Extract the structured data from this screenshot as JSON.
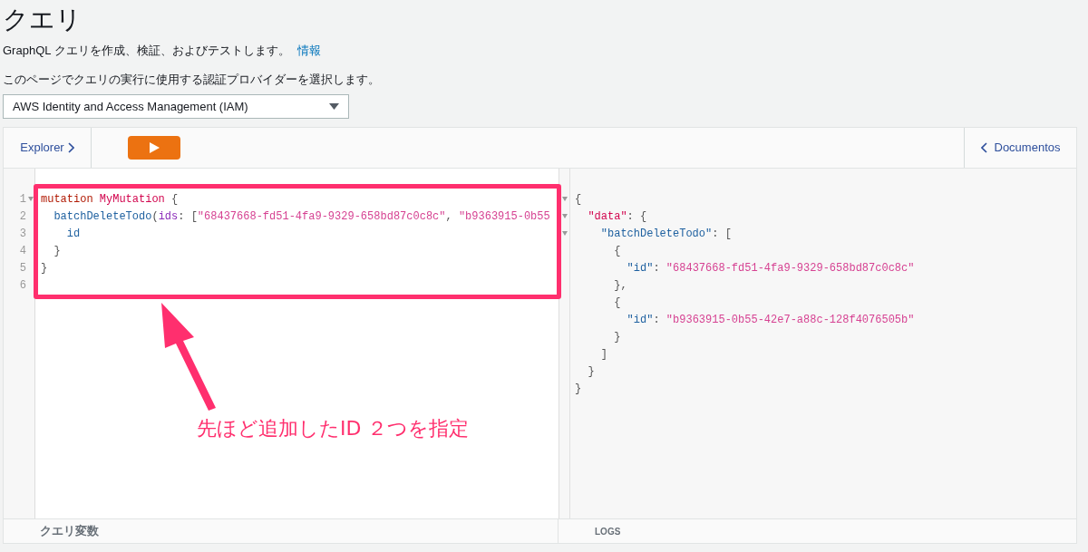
{
  "page": {
    "title": "クエリ",
    "description": "GraphQL クエリを作成、検証、およびテストします。",
    "info_link": "情報",
    "auth_note": "このページでクエリの実行に使用する認証プロバイダーを選択します。",
    "auth_select": "AWS Identity and Access Management (IAM)"
  },
  "toolbar": {
    "explorer": "Explorer",
    "docs": "Documentos"
  },
  "editor": {
    "lines": [
      {
        "number": "1",
        "foldable": true,
        "tokens": [
          {
            "kind": "keyword",
            "text": "mutation "
          },
          {
            "kind": "name",
            "text": "MyMutation"
          },
          {
            "kind": "punct",
            "text": " {"
          }
        ]
      },
      {
        "number": "2",
        "foldable": false,
        "tokens": [
          {
            "kind": "field",
            "text": "  batchDeleteTodo"
          },
          {
            "kind": "punct",
            "text": "("
          },
          {
            "kind": "arg",
            "text": "ids"
          },
          {
            "kind": "punct",
            "text": ": ["
          },
          {
            "kind": "string",
            "text": "\"68437668-fd51-4fa9-9329-658bd87c0c8c\""
          },
          {
            "kind": "punct",
            "text": ", "
          },
          {
            "kind": "string",
            "text": "\"b9363915-0b55"
          }
        ]
      },
      {
        "number": "3",
        "foldable": false,
        "tokens": [
          {
            "kind": "field",
            "text": "    id"
          }
        ]
      },
      {
        "number": "4",
        "foldable": false,
        "tokens": [
          {
            "kind": "punct",
            "text": "  }"
          }
        ]
      },
      {
        "number": "5",
        "foldable": false,
        "tokens": [
          {
            "kind": "punct",
            "text": "}"
          }
        ]
      },
      {
        "number": "6",
        "foldable": false
      }
    ]
  },
  "result": {
    "lines": [
      {
        "foldable": true,
        "tokens": [
          {
            "kind": "punct",
            "text": "{"
          }
        ]
      },
      {
        "foldable": true,
        "tokens": [
          {
            "kind": "name",
            "text": "  \"data\""
          },
          {
            "kind": "punct",
            "text": ": {"
          }
        ]
      },
      {
        "foldable": true,
        "tokens": [
          {
            "kind": "field",
            "text": "    \"batchDeleteTodo\""
          },
          {
            "kind": "punct",
            "text": ": ["
          }
        ]
      },
      {
        "foldable": false,
        "tokens": [
          {
            "kind": "punct",
            "text": "      {"
          }
        ]
      },
      {
        "foldable": false,
        "tokens": [
          {
            "kind": "field",
            "text": "        \"id\""
          },
          {
            "kind": "punct",
            "text": ": "
          },
          {
            "kind": "string",
            "text": "\"68437668-fd51-4fa9-9329-658bd87c0c8c\""
          }
        ]
      },
      {
        "foldable": false,
        "tokens": [
          {
            "kind": "punct",
            "text": "      },"
          }
        ]
      },
      {
        "foldable": false,
        "tokens": [
          {
            "kind": "punct",
            "text": "      {"
          }
        ]
      },
      {
        "foldable": false,
        "tokens": [
          {
            "kind": "field",
            "text": "        \"id\""
          },
          {
            "kind": "punct",
            "text": ": "
          },
          {
            "kind": "string",
            "text": "\"b9363915-0b55-42e7-a88c-128f4076505b\""
          }
        ]
      },
      {
        "foldable": false,
        "tokens": [
          {
            "kind": "punct",
            "text": "      }"
          }
        ]
      },
      {
        "foldable": false,
        "tokens": [
          {
            "kind": "punct",
            "text": "    ]"
          }
        ]
      },
      {
        "foldable": false,
        "tokens": [
          {
            "kind": "punct",
            "text": "  }"
          }
        ]
      },
      {
        "foldable": false,
        "tokens": [
          {
            "kind": "punct",
            "text": "}"
          }
        ]
      }
    ]
  },
  "annotation": {
    "caption": "先ほど追加したID ２つを指定"
  },
  "footer": {
    "query_variables": "クエリ変数",
    "logs": "LOGS"
  }
}
